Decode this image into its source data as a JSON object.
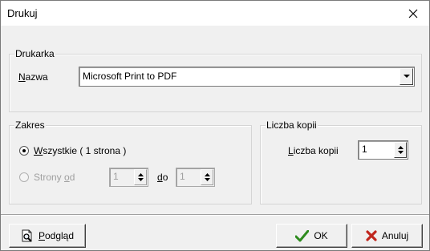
{
  "window": {
    "title": "Drukuj"
  },
  "printer_group": {
    "legend": "Drukarka",
    "name_label_mnemonic": "N",
    "name_label_rest": "azwa",
    "name_value": "Microsoft Print to PDF"
  },
  "range_group": {
    "legend": "Zakres",
    "all_mnemonic": "W",
    "all_rest": "szystkie ( 1 strona )",
    "all_checked": true,
    "pages_prefix": "Strony ",
    "pages_mnemonic": "o",
    "pages_suffix": "d",
    "from_value": "1",
    "to_mnemonic": "d",
    "to_rest": "o",
    "to_value": "1"
  },
  "copies_group": {
    "legend": "Liczba kopii",
    "label_mnemonic": "L",
    "label_rest": "iczba kopii",
    "value": "1"
  },
  "buttons": {
    "preview_mnemonic": "P",
    "preview_rest": "odgląd",
    "ok": "OK",
    "cancel": "Anuluj"
  },
  "colors": {
    "ok_check": "#2e8b1e",
    "cancel_x": "#c0261d"
  }
}
